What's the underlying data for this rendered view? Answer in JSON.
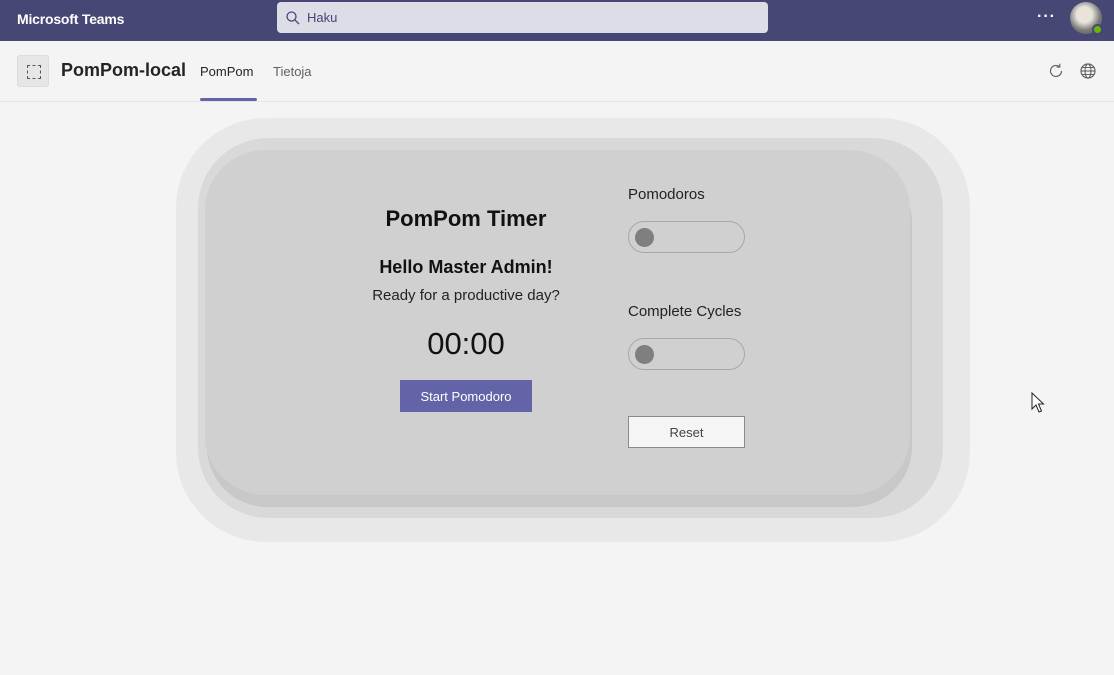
{
  "topbar": {
    "app_name": "Microsoft Teams",
    "search_placeholder": "Haku",
    "more_label": "···",
    "avatar_icon": "user-avatar-icon",
    "status": "available",
    "colors": {
      "bar": "#464775",
      "search": "#dddde8",
      "status": "#6bb700"
    }
  },
  "tabbar": {
    "app_icon": "app-placeholder-icon",
    "app_title": "PomPom-local",
    "tabs": [
      {
        "label": "PomPom",
        "active": true
      },
      {
        "label": "Tietoja",
        "active": false
      }
    ],
    "refresh_icon": "refresh-icon",
    "globe_icon": "globe-icon",
    "accent": "#6264a7"
  },
  "timer": {
    "title": "PomPom Timer",
    "greeting": "Hello Master Admin!",
    "subtitle": "Ready for a productive day?",
    "clock": "00:00",
    "start_label": "Start Pomodoro"
  },
  "settings": {
    "pomodoros_label": "Pomodoros",
    "pomodoros_on": false,
    "cycles_label": "Complete Cycles",
    "cycles_on": false,
    "reset_label": "Reset"
  }
}
